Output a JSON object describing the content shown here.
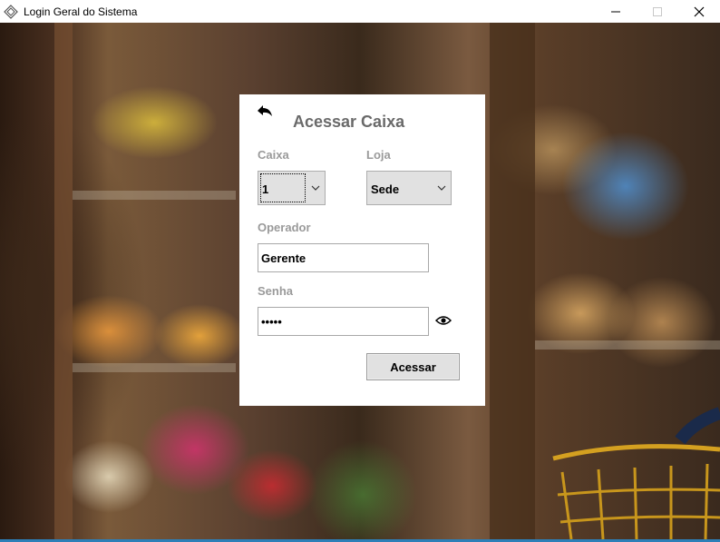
{
  "window": {
    "title": "Login Geral do Sistema",
    "controls": {
      "minimize_icon": "minimize-icon",
      "maximize_icon": "maximize-icon",
      "close_icon": "close-icon"
    }
  },
  "form": {
    "title": "Acessar Caixa",
    "back_icon": "back-arrow-icon",
    "caixa": {
      "label": "Caixa",
      "value": "1"
    },
    "loja": {
      "label": "Loja",
      "value": "Sede"
    },
    "operador": {
      "label": "Operador",
      "value": "Gerente"
    },
    "senha": {
      "label": "Senha",
      "value": "•••••",
      "toggle_icon": "eye-icon"
    },
    "submit_label": "Acessar"
  },
  "colors": {
    "title_text": "#6a6a6a",
    "label_text": "#9a9a9a",
    "card_bg": "#ffffff",
    "button_bg": "#e1e1e1"
  }
}
